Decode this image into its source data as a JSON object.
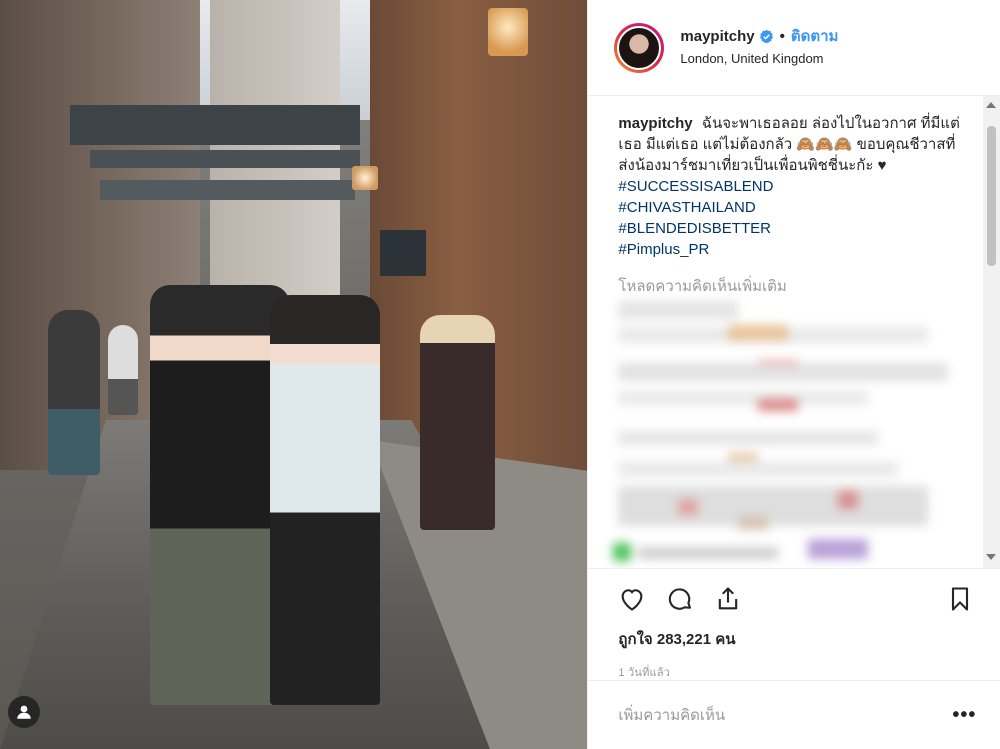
{
  "post": {
    "username": "maypitchy",
    "follow_label": "ติดตาม",
    "location": "London, United Kingdom",
    "caption": {
      "username": "maypitchy",
      "text": "ฉันจะพาเธอลอย ล่องไปในอวกาศ ที่มีแต่เธอ มีแต่เธอ แต่ไม่ต้องกลัว 🙈🙈🙈 ขอบคุณชีวาสที่ส่งน้องมาร์ชมาเที่ยวเป็นเพื่อนพิชชี่นะกัะ ♥",
      "hashtags": [
        "#SUCCESSISABLEND",
        "#CHIVASTHAILAND",
        "#BLENDEDISBETTER",
        "#Pimplus_PR"
      ]
    },
    "load_more_label": "โหลดความคิดเห็นเพิ่มเติม",
    "likes_text": "ถูกใจ 283,221 คน",
    "time_ago": "1 วันที่แล้ว",
    "add_comment_placeholder": "เพิ่มความคิดเห็น",
    "more_label": "•••"
  },
  "icons": {
    "verified": "verified-badge-icon",
    "like": "heart-icon",
    "comment": "comment-icon",
    "share": "share-icon",
    "save": "bookmark-icon",
    "tag": "user-tag-icon"
  },
  "colors": {
    "link": "#003569",
    "follow": "#3897f0",
    "verified": "#3897f0",
    "muted": "#999999",
    "text": "#262626"
  }
}
